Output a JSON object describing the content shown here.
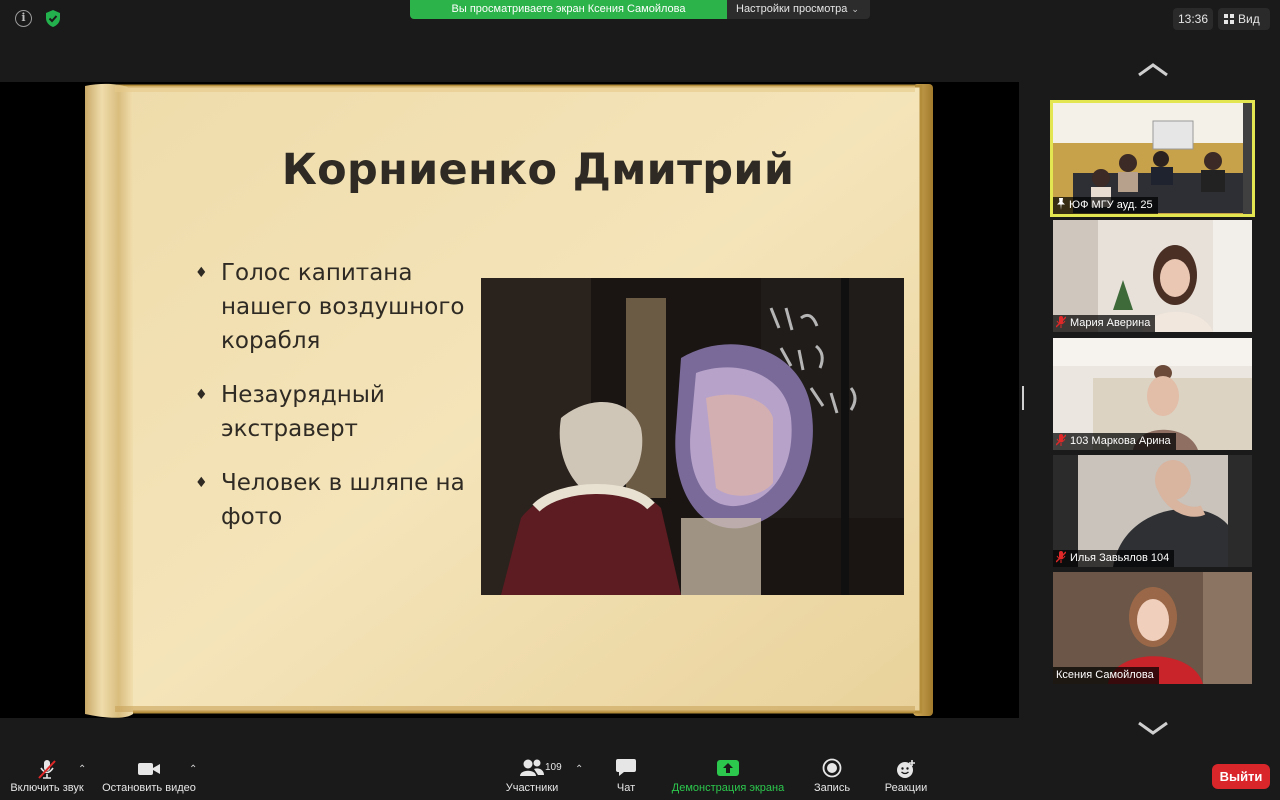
{
  "topbar": {
    "banner_text": "Вы просматриваете экран Ксения Самойлова",
    "view_options_label": "Настройки просмотра",
    "time": "13:36",
    "view_label": "Вид"
  },
  "slide": {
    "title": "Корниенко Дмитрий",
    "bullets": [
      "Голос капитана нашего воздушного корабля",
      "Незаурядный экстраверт",
      "Человек в шляпе на фото"
    ]
  },
  "participants": [
    {
      "name": "ЮФ МГУ ауд. 25",
      "pinned": true,
      "muted": false,
      "active": true
    },
    {
      "name": "Мария Аверина",
      "pinned": false,
      "muted": true,
      "active": false
    },
    {
      "name": "103 Маркова Арина",
      "pinned": false,
      "muted": true,
      "active": false
    },
    {
      "name": "Илья Завьялов 104",
      "pinned": false,
      "muted": true,
      "active": false
    },
    {
      "name": "Ксения Самойлова",
      "pinned": false,
      "muted": false,
      "active": false
    }
  ],
  "toolbar": {
    "unmute_label": "Включить звук",
    "stop_video_label": "Остановить видео",
    "participants_label": "Участники",
    "participants_count": "109",
    "chat_label": "Чат",
    "share_label": "Демонстрация экрана",
    "record_label": "Запись",
    "reactions_label": "Реакции",
    "leave_label": "Выйти"
  },
  "colors": {
    "banner_green": "#2cb34a",
    "share_green": "#2cc84d",
    "leave_red": "#d9262b",
    "active_speaker": "#e3e650",
    "muted_red": "#e02828"
  }
}
